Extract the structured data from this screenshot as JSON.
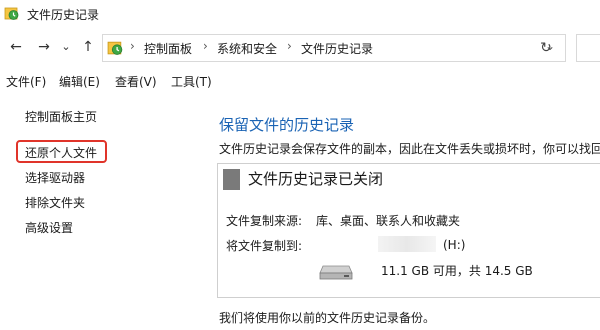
{
  "window": {
    "title": "文件历史记录"
  },
  "nav": {
    "back_glyph": "←",
    "forward_glyph": "→",
    "recent_glyph": "⌄",
    "up_glyph": "↑",
    "breadcrumbs": [
      "控制面板",
      "系统和安全",
      "文件历史记录"
    ],
    "separator": "›",
    "dropdown_glyph": "⌄",
    "refresh_glyph": "↻"
  },
  "menu": {
    "items": [
      "文件(F)",
      "编辑(E)",
      "查看(V)",
      "工具(T)"
    ]
  },
  "sidebar": {
    "items": [
      "控制面板主页",
      "还原个人文件",
      "选择驱动器",
      "排除文件夹",
      "高级设置"
    ],
    "highlighted_index": 1,
    "highlight_color": "#e0342a"
  },
  "main": {
    "title": "保留文件的历史记录",
    "description": "文件历史记录会保存文件的副本，因此在文件丢失或损坏时，你可以找回",
    "panel": {
      "status_title": "文件历史记录已关闭",
      "source_label": "文件复制来源:",
      "source_value": "库、桌面、联系人和收藏夹",
      "dest_label": "将文件复制到:",
      "drive_name": "(H:)",
      "drive_space": "11.1 GB 可用，共 14.5 GB"
    },
    "bottom_note": "我们将使用你以前的文件历史记录备份。"
  },
  "colors": {
    "title_blue": "#1a63b4",
    "status_bar": "#7a7a7a"
  }
}
